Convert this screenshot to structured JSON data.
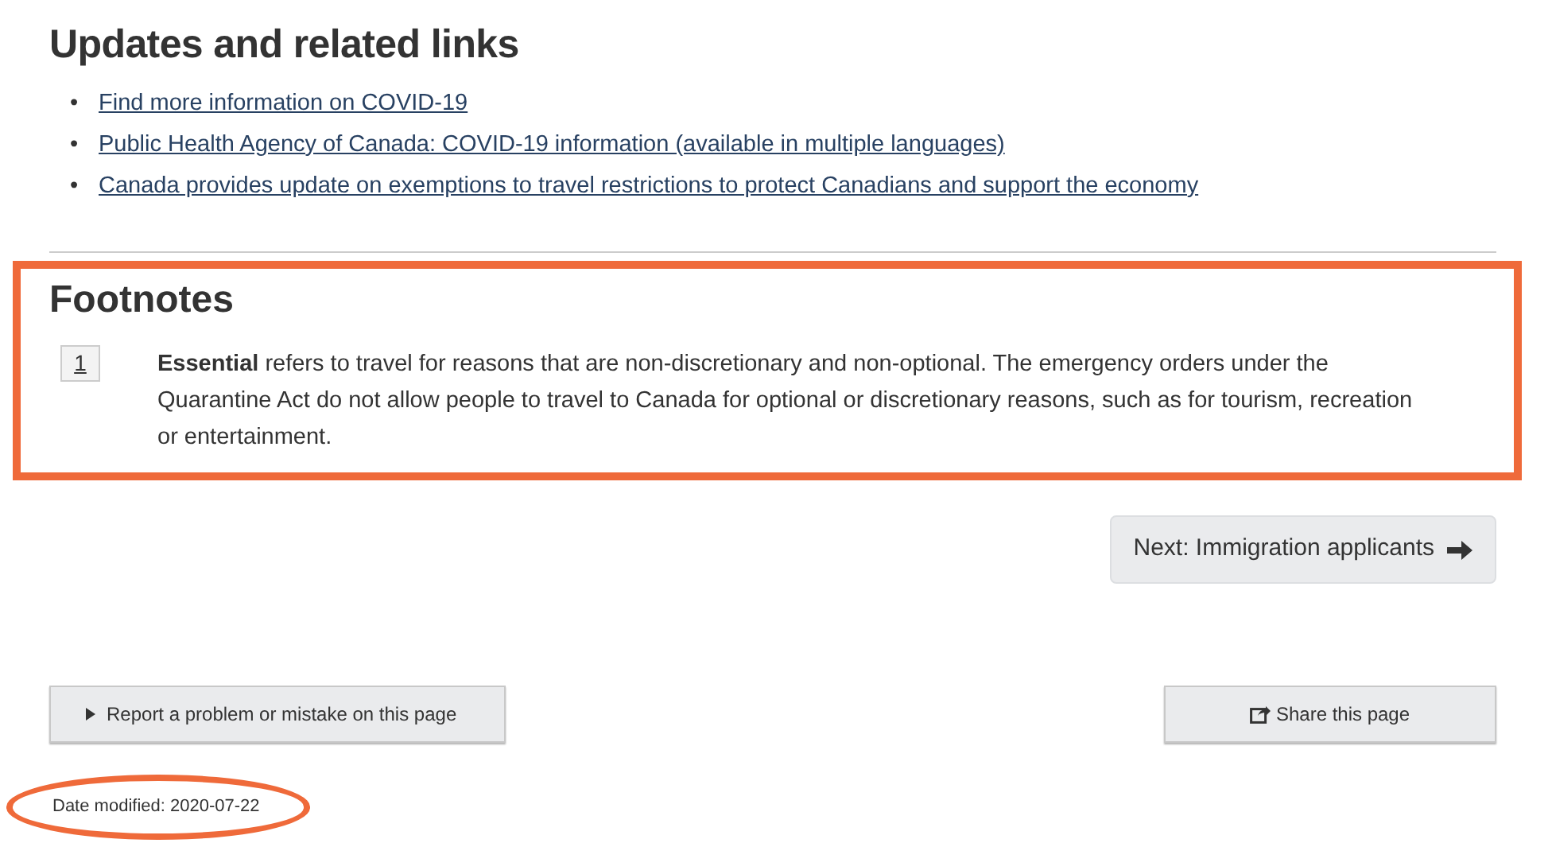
{
  "updates": {
    "heading": "Updates and related links",
    "bullet": "•",
    "links": [
      "Find more information on COVID-19",
      "Public Health Agency of Canada: COVID-19 information (available in multiple languages)",
      "Canada provides update on exemptions to travel restrictions to protect Canadians and support the economy"
    ]
  },
  "footnotes": {
    "heading": "Footnotes",
    "items": [
      {
        "number": "1",
        "text": "**Essential** refers to travel for reasons that are non-discretionary and non-optional. The emergency orders under the Quarantine Act do not allow people to travel to Canada for optional or discretionary reasons, such as for tourism, recreation or entertainment."
      }
    ]
  },
  "next_button": "Next: Immigration applicants",
  "report_button": "Report a problem or mistake on this page",
  "share_button": "Share this page",
  "date_modified": "Date modified: 2020-07-22"
}
